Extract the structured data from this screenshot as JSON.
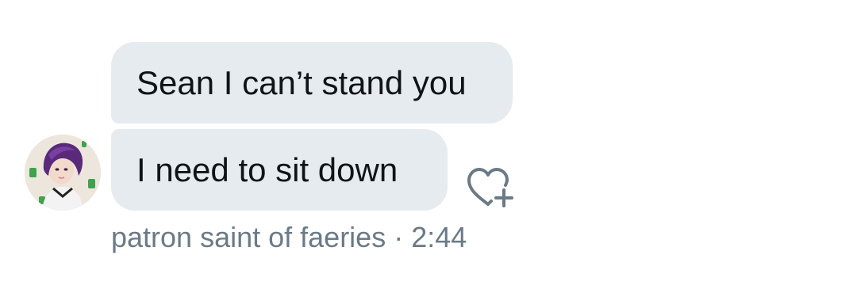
{
  "messages": [
    {
      "text": "Sean I can’t stand you"
    },
    {
      "text": "I need to sit down"
    }
  ],
  "sender": {
    "name": "patron saint of faeries",
    "avatar_icon": "user-avatar"
  },
  "timestamp": "2:44",
  "separator": "·",
  "reaction": {
    "icon": "heart-plus-icon"
  },
  "colors": {
    "bubble": "#e6ebef",
    "text": "#0f1419",
    "meta_text": "#6b7a86",
    "icon": "#6b7a86"
  }
}
